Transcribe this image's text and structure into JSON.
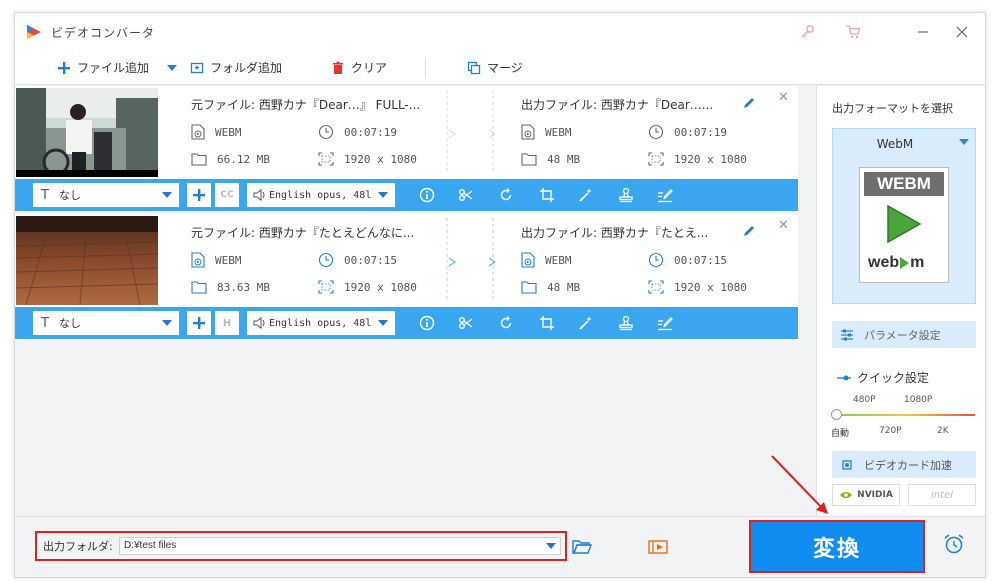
{
  "window": {
    "title": "ビデオコンバータ"
  },
  "toolbar": {
    "add_file": "ファイル追加",
    "add_folder": "フォルダ追加",
    "clear": "クリア",
    "merge": "マージ"
  },
  "items": [
    {
      "source_title": "元ファイル: 西野カナ『Dear…』 FULL-...",
      "source_format": "WEBM",
      "source_duration": "00:07:19",
      "source_size": "66.12 MB",
      "source_resolution": "1920 x 1080",
      "output_title": "出力ファイル: 西野カナ『Dear…...",
      "output_format": "WEBM",
      "output_duration": "00:07:19",
      "output_size": "48 MB",
      "output_resolution": "1920 x 1080",
      "subtitle": "なし",
      "audio": "English opus, 48l"
    },
    {
      "source_title": "元ファイル: 西野カナ『たとえどんなに...",
      "source_format": "WEBM",
      "source_duration": "00:07:15",
      "source_size": "83.63 MB",
      "source_resolution": "1920 x 1080",
      "output_title": "出力ファイル: 西野カナ『たとえ...",
      "output_format": "WEBM",
      "output_duration": "00:07:15",
      "output_size": "48 MB",
      "output_resolution": "1920 x 1080",
      "subtitle": "なし",
      "audio": "English opus, 48l"
    }
  ],
  "right_panel": {
    "select_format_label": "出力フォーマットを選択",
    "format_name": "WebM",
    "format_icon_top": "WEBM",
    "format_icon_bottom_left": "web",
    "format_icon_bottom_right": "m",
    "param_settings": "パラメータ設定",
    "quick_settings": "クイック設定",
    "quality_top_labels": [
      "480P",
      "1080P"
    ],
    "quality_bottom_labels": [
      "自動",
      "720P",
      "2K"
    ],
    "gpu_accel": "ビデオカード加速",
    "nvidia": "NVIDIA",
    "intel": "intel"
  },
  "bottom": {
    "output_folder_label": "出力フォルダ:",
    "output_path": "D:¥test files",
    "convert_button": "変換"
  },
  "colors": {
    "accent_blue": "#3aa6ef",
    "convert_blue": "#0f8df0",
    "highlight_red": "#e02020",
    "panel_light_blue": "#d8ecfb",
    "orange_icon": "#ef6c00"
  }
}
